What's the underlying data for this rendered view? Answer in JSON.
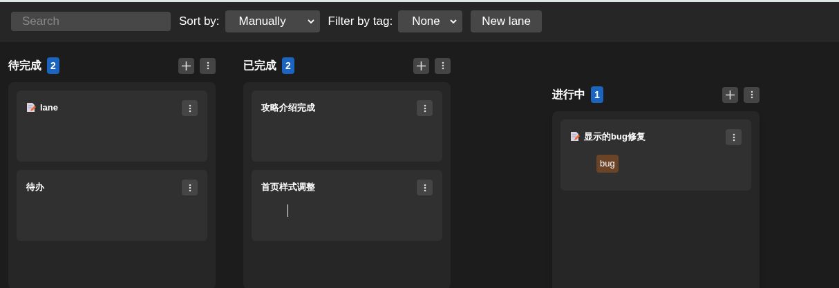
{
  "toolbar": {
    "search": {
      "placeholder": "Search"
    },
    "sort_label": "Sort by:",
    "sort_value": "Manually",
    "filter_label": "Filter by tag:",
    "filter_value": "None",
    "new_lane": "New lane"
  },
  "lanes": [
    {
      "title": "待完成",
      "count": "2",
      "lifted": false,
      "cards": [
        {
          "title": "lane",
          "icon": true,
          "cursor": false
        },
        {
          "title": "待办",
          "icon": false,
          "cursor": false
        }
      ]
    },
    {
      "title": "已完成",
      "count": "2",
      "lifted": false,
      "cards": [
        {
          "title": "攻略介绍完成",
          "icon": false,
          "cursor": false
        },
        {
          "title": "首页样式调整",
          "icon": false,
          "cursor": true
        }
      ]
    },
    {
      "title": "进行中",
      "count": "1",
      "lifted": true,
      "cards": [
        {
          "title": "显示的bug修复",
          "icon": true,
          "cursor": false,
          "tags": [
            {
              "label": "bug",
              "color": "#6b4428"
            }
          ]
        }
      ]
    }
  ]
}
